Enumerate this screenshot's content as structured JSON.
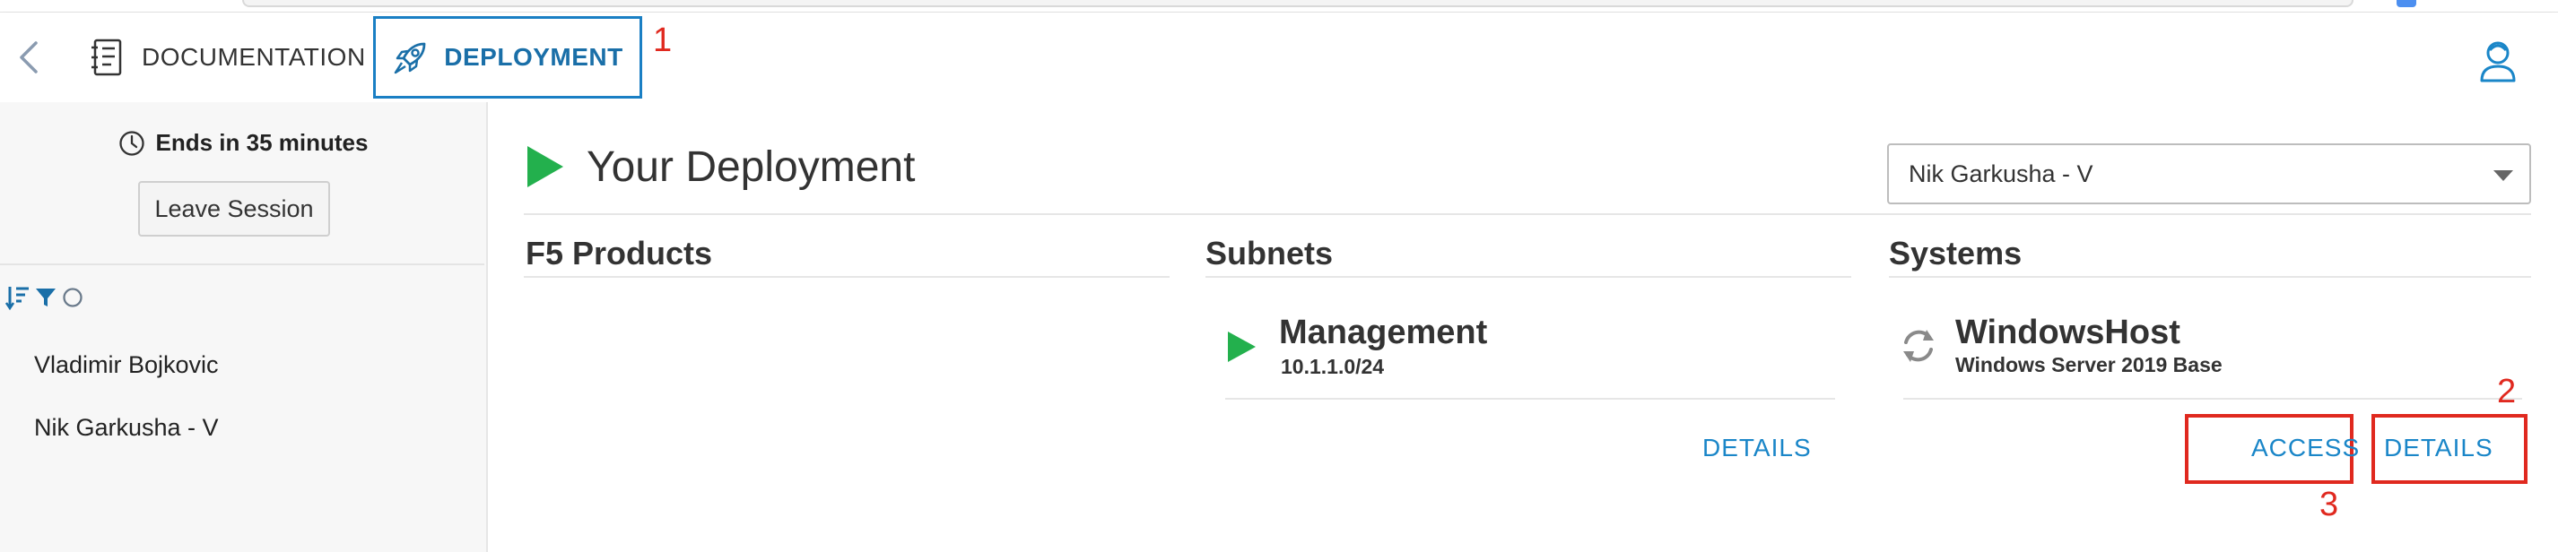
{
  "nav": {
    "tabs": [
      {
        "label": "DOCUMENTATION",
        "icon": "notebook-icon"
      },
      {
        "label": "DEPLOYMENT",
        "icon": "rocket-icon",
        "active": true
      }
    ],
    "annotation_1": "1",
    "accent_color": "#1a7fc4"
  },
  "sidebar": {
    "ends_text": "Ends in 35 minutes",
    "leave_button": "Leave Session",
    "sessions": [
      "Vladimir Bojkovic",
      "Nik Garkusha - V"
    ]
  },
  "deployment": {
    "title": "Your Deployment",
    "user_select": "Nik Garkusha - V",
    "columns": {
      "products": "F5 Products",
      "subnets": "Subnets",
      "systems": "Systems"
    },
    "subnet": {
      "name": "Management",
      "cidr": "10.1.1.0/24",
      "details": "DETAILS"
    },
    "system": {
      "name": "WindowsHost",
      "os": "Windows Server 2019 Base",
      "access": "ACCESS",
      "details": "DETAILS"
    }
  },
  "annotations": {
    "two": "2",
    "three": "3",
    "color": "#e0291f"
  }
}
